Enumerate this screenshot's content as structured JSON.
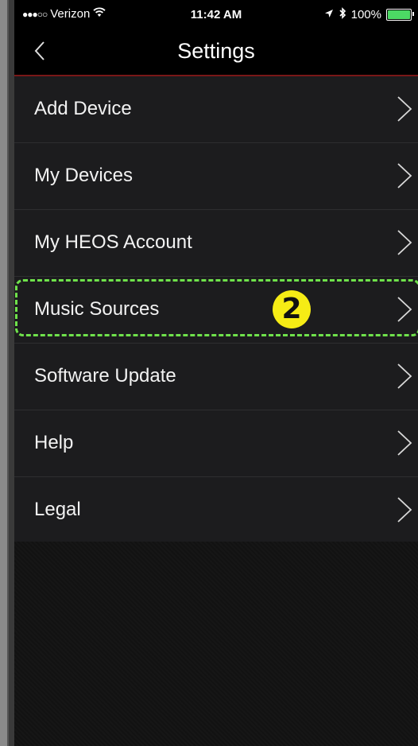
{
  "status_bar": {
    "signal": "●●●○○",
    "carrier": "Verizon",
    "time": "11:42 AM",
    "battery": "100%",
    "icons": [
      "wifi-icon",
      "location-arrow-icon",
      "bluetooth-icon",
      "battery-icon"
    ]
  },
  "nav": {
    "title": "Settings",
    "back_icon": "chevron-left-icon"
  },
  "menu": [
    {
      "label": "Add Device"
    },
    {
      "label": "My Devices"
    },
    {
      "label": "My HEOS Account"
    },
    {
      "label": "Music Sources",
      "annotation": "2"
    },
    {
      "label": "Software Update"
    },
    {
      "label": "Help"
    },
    {
      "label": "Legal"
    }
  ],
  "colors": {
    "accent_border": "#7a1717",
    "highlight": "#6fe24b",
    "badge": "#f6ec15",
    "battery": "#4cd964"
  }
}
